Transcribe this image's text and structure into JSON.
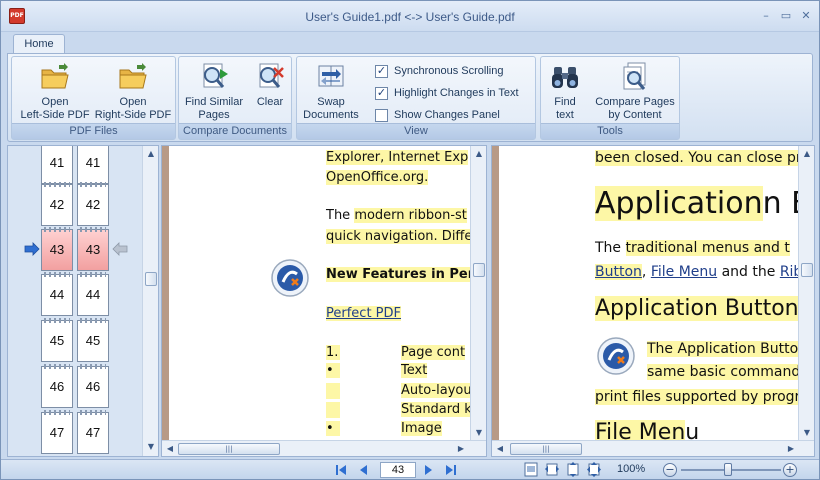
{
  "window": {
    "title": "User's Guide1.pdf <-> User's Guide.pdf",
    "app_icon_label": "PDF",
    "controls": {
      "minimize": "–",
      "restore": "▭",
      "close": "✕"
    }
  },
  "tabs": [
    {
      "label": "Home",
      "active": true
    }
  ],
  "ribbon": {
    "groups": [
      {
        "label": "PDF Files",
        "buttons": [
          {
            "line1": "Open",
            "line2": "Left-Side PDF",
            "icon": "folder-open-icon"
          },
          {
            "line1": "Open",
            "line2": "Right-Side PDF",
            "icon": "folder-open-icon"
          }
        ]
      },
      {
        "label": "Compare Documents",
        "buttons": [
          {
            "line1": "Find Similar",
            "line2": "Pages",
            "icon": "magnifier-play-icon"
          },
          {
            "line1": "Clear",
            "line2": "",
            "icon": "magnifier-clear-icon"
          }
        ]
      },
      {
        "label": "View",
        "buttons": [
          {
            "line1": "Swap",
            "line2": "Documents",
            "icon": "swap-icon"
          }
        ],
        "checkboxes": [
          {
            "label": "Synchronous Scrolling",
            "checked": true
          },
          {
            "label": "Highlight Changes in Text",
            "checked": true
          },
          {
            "label": "Show Changes Panel",
            "checked": false
          }
        ]
      },
      {
        "label": "Tools",
        "buttons": [
          {
            "line1": "Find",
            "line2": "text",
            "icon": "binoculars-icon"
          },
          {
            "line1": "Compare Pages",
            "line2": "by Content",
            "icon": "compare-pages-icon"
          }
        ]
      }
    ]
  },
  "thumbnails": {
    "left": [
      "41",
      "42",
      "43",
      "44",
      "45",
      "46",
      "47"
    ],
    "right": [
      "41",
      "42",
      "43",
      "44",
      "45",
      "46",
      "47"
    ],
    "current": "43"
  },
  "left_doc": {
    "line1": "Explorer, Internet Exp",
    "line2": "OpenOffice.org.",
    "para_a": "The ",
    "para_b": "modern ribbon-st",
    "line4": "quick navigation. Diffe",
    "heading": "New Features in Perfe",
    "link": "Perfect PDF",
    "list": [
      {
        "marker": "1.",
        "text": "Page cont"
      },
      {
        "marker": "•",
        "text": "Text"
      },
      {
        "marker": "",
        "text": "Auto-layou"
      },
      {
        "marker": "",
        "text": "Standard k"
      },
      {
        "marker": "•",
        "text": "Image"
      }
    ]
  },
  "right_doc": {
    "line1": "been closed. You can close pr",
    "h1_a": "Application",
    "h1_b": "n But",
    "p1_a": "The ",
    "p1_b": "traditional menus and t",
    "link1": "Button",
    "sep1": ", ",
    "link2": "File Menu",
    "mid": " and the ",
    "link3": "Rib",
    "h2": "Application Button",
    "p2_a": "The Application Butto",
    "p2_b": "same basic command",
    "p2_c": "print files supported by progra",
    "h3_a": "File Men",
    "h3_b": "u"
  },
  "statusbar": {
    "page": "43",
    "zoom": "100%",
    "zoom_level_percent": 100,
    "zoom_out": "−",
    "zoom_in": "+"
  },
  "colors": {
    "highlight": "#fdf7a6",
    "accent": "#1e395b",
    "thumb_highlight": "#f2a0a0"
  }
}
